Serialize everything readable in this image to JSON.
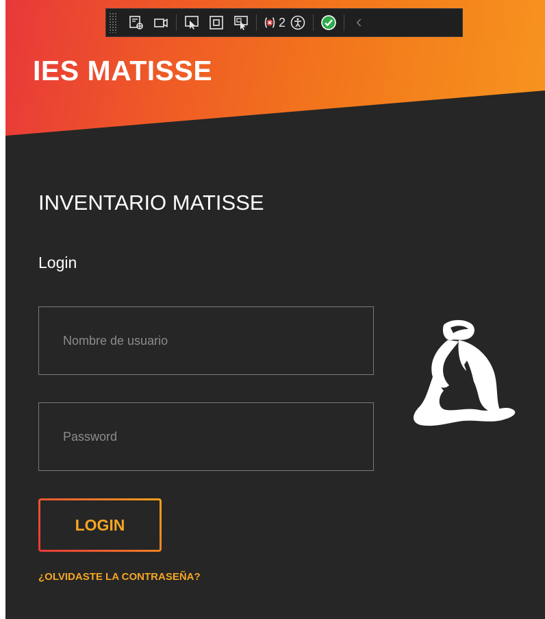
{
  "header": {
    "brand": "IES MATISSE"
  },
  "debug_toolbar": {
    "error_count": "2",
    "tools": [
      "select-element-icon",
      "video-camera-icon",
      "display-layout-adorners-icon",
      "track-focused-element-icon",
      "preview-selection-icon",
      "errors-icon",
      "accessibility-icon",
      "hot-reload-ok-icon",
      "collapse-toolbar-icon"
    ]
  },
  "main": {
    "app_title": "INVENTARIO MATISSE",
    "section_title": "Login",
    "username": {
      "placeholder": "Nombre de usuario",
      "value": ""
    },
    "password": {
      "placeholder": "Password",
      "value": ""
    },
    "login_button": "LOGIN",
    "forgot_link": "¿OLVIDASTE LA CONTRASEÑA?"
  },
  "logo": {
    "icon": "matisse-figure-logo-icon"
  },
  "colors": {
    "background": "#262626",
    "accent_orange": "#f5a623",
    "gradient_start": "#e8383a",
    "gradient_end": "#f7941e",
    "border": "#7a7a7a",
    "text": "#ffffff"
  }
}
